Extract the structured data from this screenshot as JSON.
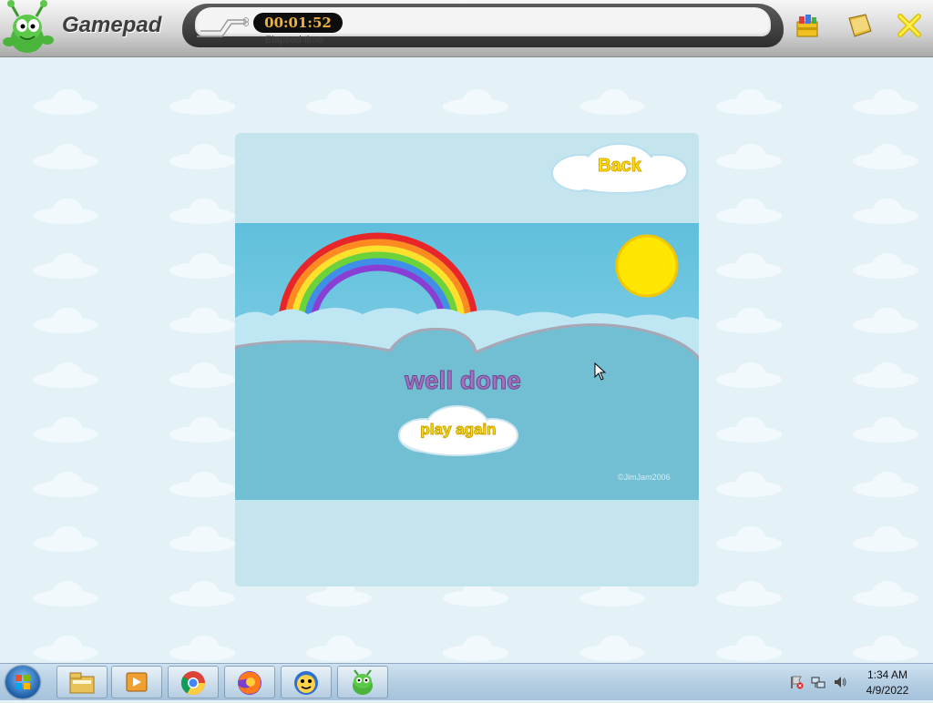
{
  "topbar": {
    "brand": "Gamepad",
    "timer": "00:01:52",
    "timer_label": "Elapsed time",
    "icons": [
      "games-box-icon",
      "book-icon",
      "close-icon"
    ]
  },
  "game": {
    "back_label": "Back",
    "message": "well done",
    "play_again_label": "play again",
    "copyright": "©JimJam2006"
  },
  "taskbar": {
    "apps": [
      "file-explorer-icon",
      "media-player-icon",
      "chrome-icon",
      "firefox-icon",
      "smiley-app-icon",
      "gamepad-alien-icon"
    ],
    "time": "1:34 AM",
    "date": "4/9/2022"
  },
  "colors": {
    "sky": "#6fc6df",
    "hill": "#72bfd3",
    "panel": "#c4e4ee",
    "sun": "#ffe600",
    "message": "#a371c4",
    "button_text": "#ffe600"
  }
}
